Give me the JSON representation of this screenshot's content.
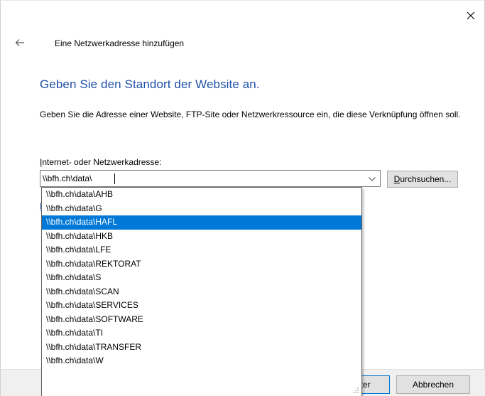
{
  "window": {
    "title": "Eine Netzwerkadresse hinzufügen",
    "close_icon": "close-icon",
    "back_icon": "back-arrow-icon"
  },
  "page": {
    "heading": "Geben Sie den Standort der Website an.",
    "description": "Geben Sie die Adresse einer Website, FTP-Site oder Netzwerkressource ein, die diese Verknüpfung öffnen soll.",
    "field_label_mnemonic": "I",
    "field_label_rest": "nternet- oder Netzwerkadresse:",
    "address_value": "\\\\bfh.ch\\data\\",
    "browse_mnemonic": "D",
    "browse_rest": "urchsuchen...",
    "examples_link_partial": "B"
  },
  "dropdown": {
    "selected_index": 2,
    "items": [
      "\\\\bfh.ch\\data\\AHB",
      "\\\\bfh.ch\\data\\G",
      "\\\\bfh.ch\\data\\HAFL",
      "\\\\bfh.ch\\data\\HKB",
      "\\\\bfh.ch\\data\\LFE",
      "\\\\bfh.ch\\data\\REKTORAT",
      "\\\\bfh.ch\\data\\S",
      "\\\\bfh.ch\\data\\SCAN",
      "\\\\bfh.ch\\data\\SERVICES",
      "\\\\bfh.ch\\data\\SOFTWARE",
      "\\\\bfh.ch\\data\\TI",
      "\\\\bfh.ch\\data\\TRANSFER",
      "\\\\bfh.ch\\data\\W"
    ]
  },
  "footer": {
    "next_label_visible": "eiter",
    "cancel_label": "Abbrechen"
  },
  "colors": {
    "heading": "#1f4fa8",
    "selection": "#0078d7",
    "footer_bg": "#f0f0f0",
    "button_bg": "#e1e1e1"
  }
}
